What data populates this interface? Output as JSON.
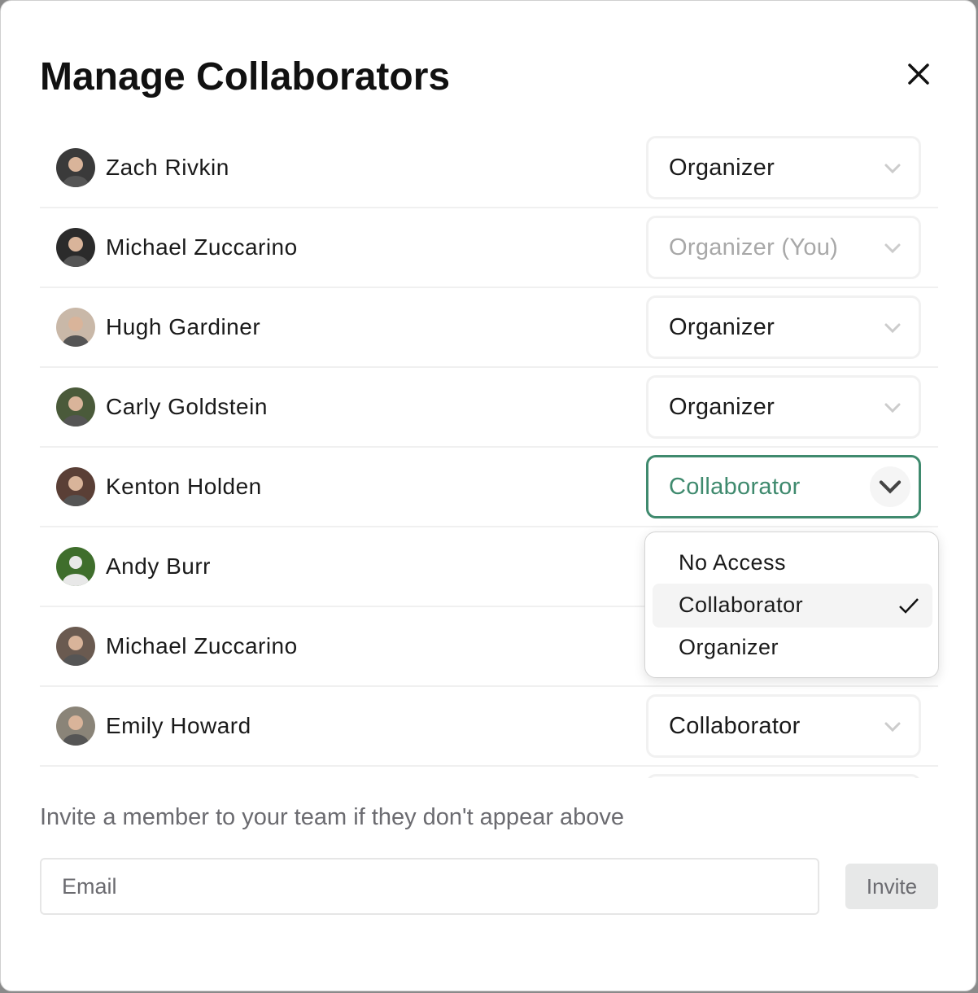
{
  "title": "Manage Collaborators",
  "collaborators": [
    {
      "name": "Zach Rivkin",
      "role": "Organizer",
      "avatar": "#3a3a3a"
    },
    {
      "name": "Michael Zuccarino",
      "role": "Organizer (You)",
      "disabled": true,
      "avatar": "#2b2b2b"
    },
    {
      "name": "Hugh Gardiner",
      "role": "Organizer",
      "avatar": "#c9b8a8"
    },
    {
      "name": "Carly Goldstein",
      "role": "Organizer",
      "avatar": "#4a5a3a"
    },
    {
      "name": "Kenton Holden",
      "role": "Collaborator",
      "active": true,
      "avatar": "#5a3f36"
    },
    {
      "name": "Andy Burr",
      "role": "",
      "avatar": "#3f6e2c",
      "default_avatar": true
    },
    {
      "name": "Michael Zuccarino",
      "role": "",
      "avatar": "#6a5a50"
    },
    {
      "name": "Emily Howard",
      "role": "Collaborator",
      "avatar": "#8a8478"
    }
  ],
  "dropdown": {
    "options": [
      "No Access",
      "Collaborator",
      "Organizer"
    ],
    "selected": "Collaborator"
  },
  "invite": {
    "hint": "Invite a member to your team if they don't appear above",
    "email_placeholder": "Email",
    "button": "Invite"
  },
  "colors": {
    "accent": "#3f8a6e"
  }
}
